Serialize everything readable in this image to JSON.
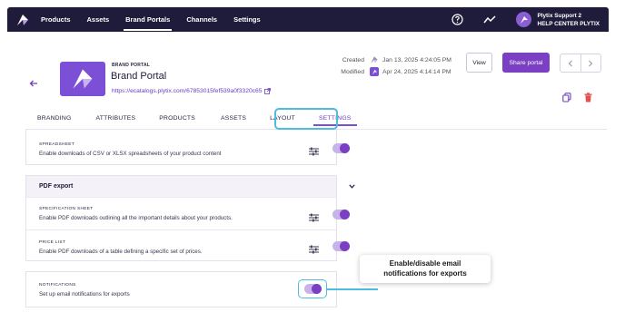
{
  "nav": {
    "items": [
      {
        "label": "Products"
      },
      {
        "label": "Assets"
      },
      {
        "label": "Brand Portals"
      },
      {
        "label": "Channels"
      },
      {
        "label": "Settings"
      }
    ],
    "user_name": "Plytix Support 2",
    "user_org": "HELP CENTER PLYTIX"
  },
  "header": {
    "kicker": "BRAND PORTAL",
    "title": "Brand Portal",
    "url": "https://ecatalogs.plytix.com/67853015fef539a0f3320c65",
    "created_label": "Created",
    "created_value": "Jan 13, 2025 4:24:05 PM",
    "modified_label": "Modified",
    "modified_value": "Apr 24, 2025 4:14:14 PM",
    "view_label": "View",
    "share_label": "Share portal"
  },
  "tabs": [
    {
      "label": "BRANDING"
    },
    {
      "label": "ATTRIBUTES"
    },
    {
      "label": "PRODUCTS"
    },
    {
      "label": "ASSETS"
    },
    {
      "label": "LAYOUT"
    },
    {
      "label": "SETTINGS"
    }
  ],
  "settings": {
    "spreadsheet": {
      "title": "SPREADSHEET",
      "desc": "Enable downloads of CSV or XLSX spreadsheets of your product content",
      "enabled": true
    },
    "pdf_section": {
      "title": "PDF export"
    },
    "spec_sheet": {
      "title": "SPECIFICATION SHEET",
      "desc": "Enable PDF downloads outlining all the important details about your products.",
      "enabled": true
    },
    "price_list": {
      "title": "PRICE LIST",
      "desc": "Enable PDF downloads of a table defining a specific set of prices.",
      "enabled": true
    },
    "notifications": {
      "title": "NOTIFICATIONS",
      "desc": "Set up email notifications for exports",
      "enabled": true
    }
  },
  "callout": {
    "line1": "Enable/disable email",
    "line2": "notifications for exports"
  },
  "colors": {
    "nav_bg": "#1f1b3a",
    "brand_purple": "#7b3fc4",
    "highlight_blue": "#4cbce0"
  }
}
